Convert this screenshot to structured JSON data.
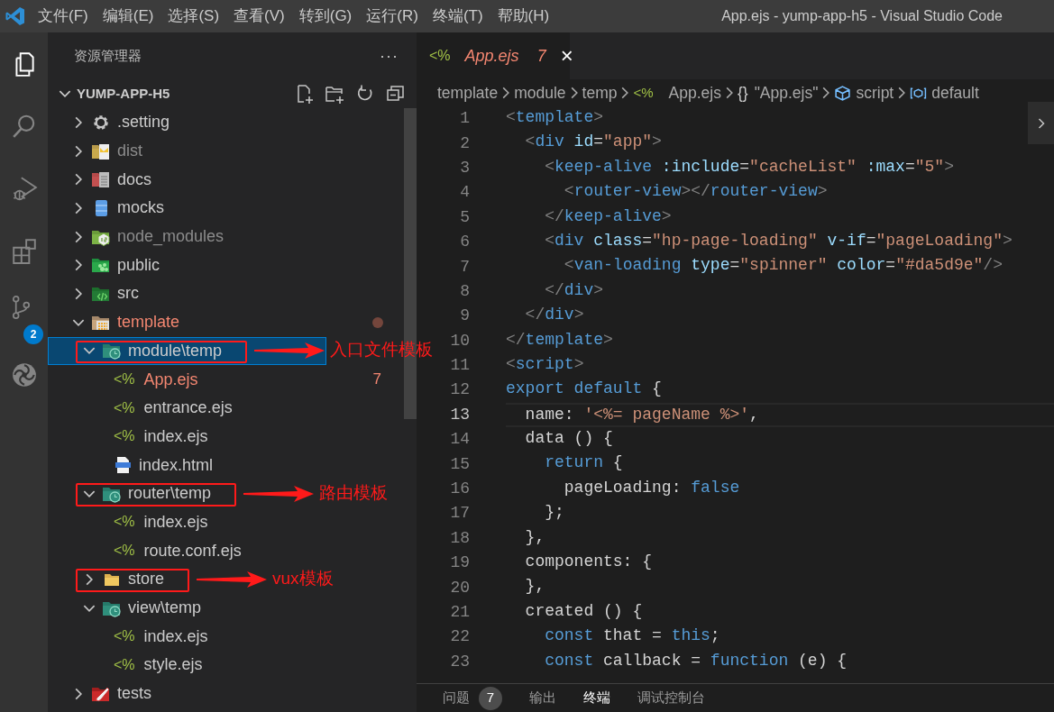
{
  "title_bar": {
    "menus": [
      "文件(F)",
      "编辑(E)",
      "选择(S)",
      "查看(V)",
      "转到(G)",
      "运行(R)",
      "终端(T)",
      "帮助(H)"
    ],
    "title": "App.ejs - yump-app-h5 - Visual Studio Code"
  },
  "activity_bar": [
    {
      "kind": "explorer",
      "selected": true
    },
    {
      "kind": "search",
      "selected": false
    },
    {
      "kind": "run-debug",
      "selected": false
    },
    {
      "kind": "extensions",
      "selected": false
    },
    {
      "kind": "source-control",
      "selected": false,
      "badge": "2"
    },
    {
      "kind": "spiral",
      "selected": false
    }
  ],
  "sidebar": {
    "title": "资源管理器",
    "more": "···",
    "section": {
      "title": "YUMP-APP-H5",
      "expanded": true
    },
    "tree": [
      {
        "name": ".setting",
        "kind": "settings-folder",
        "expanded": false,
        "ignored": false,
        "error": false,
        "selected": false,
        "modified": false
      },
      {
        "name": "dist",
        "kind": "dist-folder",
        "expanded": false,
        "ignored": true,
        "error": false,
        "selected": false,
        "modified": false
      },
      {
        "name": "docs",
        "kind": "docs-folder",
        "expanded": false,
        "ignored": false,
        "error": false,
        "selected": false,
        "modified": false
      },
      {
        "name": "mocks",
        "kind": "mocks-folder",
        "expanded": false,
        "ignored": false,
        "error": false,
        "selected": false,
        "modified": false
      },
      {
        "name": "node_modules",
        "kind": "node-folder",
        "expanded": false,
        "ignored": true,
        "error": false,
        "selected": false,
        "modified": false
      },
      {
        "name": "public",
        "kind": "public-folder",
        "expanded": false,
        "ignored": false,
        "error": false,
        "selected": false,
        "modified": false
      },
      {
        "name": "src",
        "kind": "src-folder",
        "expanded": false,
        "ignored": false,
        "error": false,
        "selected": false,
        "modified": false
      },
      {
        "name": "template",
        "kind": "template-folder",
        "expanded": true,
        "ignored": false,
        "error": true,
        "selected": false,
        "modified": true,
        "children": [
          {
            "name": "module\\temp",
            "kind": "temp-folder",
            "expanded": true,
            "ignored": false,
            "error": false,
            "selected": true,
            "modified": false,
            "annotation": "入口文件模板",
            "children": [
              {
                "name": "App.ejs",
                "kind": "ejs-file",
                "glyph": "<%",
                "ignored": false,
                "error": true,
                "selected": false,
                "modified": false,
                "badge": "7"
              },
              {
                "name": "entrance.ejs",
                "kind": "ejs-file",
                "glyph": "<%",
                "ignored": false,
                "error": false,
                "selected": false,
                "modified": false
              },
              {
                "name": "index.ejs",
                "kind": "ejs-file",
                "glyph": "<%",
                "ignored": false,
                "error": false,
                "selected": false,
                "modified": false
              },
              {
                "name": "index.html",
                "kind": "html-file",
                "ignored": false,
                "error": false,
                "selected": false,
                "modified": false
              }
            ]
          },
          {
            "name": "router\\temp",
            "kind": "temp-folder",
            "expanded": true,
            "ignored": false,
            "error": false,
            "selected": false,
            "modified": false,
            "annotation": "路由模板",
            "children": [
              {
                "name": "index.ejs",
                "kind": "ejs-file",
                "glyph": "<%",
                "ignored": false,
                "error": false,
                "selected": false,
                "modified": false
              },
              {
                "name": "route.conf.ejs",
                "kind": "ejs-file",
                "glyph": "<%",
                "ignored": false,
                "error": false,
                "selected": false,
                "modified": false
              }
            ]
          },
          {
            "name": "store",
            "kind": "folder",
            "expanded": false,
            "ignored": false,
            "error": false,
            "selected": false,
            "modified": false,
            "annotation": "vux模板"
          },
          {
            "name": "view\\temp",
            "kind": "temp-folder",
            "expanded": true,
            "ignored": false,
            "error": false,
            "selected": false,
            "modified": false,
            "children": [
              {
                "name": "index.ejs",
                "kind": "ejs-file",
                "glyph": "<%",
                "ignored": false,
                "error": false,
                "selected": false,
                "modified": false
              },
              {
                "name": "style.ejs",
                "kind": "ejs-file",
                "glyph": "<%",
                "ignored": false,
                "error": false,
                "selected": false,
                "modified": false
              }
            ]
          }
        ]
      },
      {
        "name": "tests",
        "kind": "tests-folder",
        "expanded": false,
        "ignored": false,
        "error": false,
        "selected": false,
        "modified": false
      }
    ]
  },
  "editor": {
    "tabs": [
      {
        "glyph": "<%",
        "title": "App.ejs",
        "badge": "7",
        "error": true,
        "preview": true,
        "selected": true,
        "close": "×"
      }
    ],
    "breadcrumb": [
      {
        "kind": "folder",
        "text": "template"
      },
      {
        "kind": "folder",
        "text": "module"
      },
      {
        "kind": "folder",
        "text": "temp"
      },
      {
        "kind": "file",
        "glyph": "<%",
        "text": "App.ejs"
      },
      {
        "kind": "object",
        "glyph": "{}",
        "text": "\"App.ejs\""
      },
      {
        "kind": "module",
        "text": "script"
      },
      {
        "kind": "variable",
        "text": "default"
      }
    ],
    "lines": [
      {
        "number": "1",
        "current": false,
        "tokens": [
          {
            "kind": "bracket",
            "text": "<"
          },
          {
            "kind": "tag",
            "text": "template"
          },
          {
            "kind": "bracket",
            "text": ">"
          }
        ]
      },
      {
        "number": "2",
        "current": false,
        "tokens": [
          {
            "kind": "bracket",
            "text": "  <"
          },
          {
            "kind": "tag",
            "text": "div"
          },
          {
            "kind": "attr",
            "text": " id"
          },
          {
            "kind": "plain",
            "text": "="
          },
          {
            "kind": "string",
            "text": "\"app\""
          },
          {
            "kind": "bracket",
            "text": ">"
          }
        ]
      },
      {
        "number": "3",
        "current": false,
        "tokens": [
          {
            "kind": "bracket",
            "text": "    <"
          },
          {
            "kind": "tag",
            "text": "keep-alive"
          },
          {
            "kind": "attr",
            "text": " :include"
          },
          {
            "kind": "plain",
            "text": "="
          },
          {
            "kind": "string",
            "text": "\"cacheList\""
          },
          {
            "kind": "attr",
            "text": " :max"
          },
          {
            "kind": "plain",
            "text": "="
          },
          {
            "kind": "string",
            "text": "\"5\""
          },
          {
            "kind": "bracket",
            "text": ">"
          }
        ]
      },
      {
        "number": "4",
        "current": false,
        "tokens": [
          {
            "kind": "bracket",
            "text": "      <"
          },
          {
            "kind": "tag",
            "text": "router-view"
          },
          {
            "kind": "bracket",
            "text": "></"
          },
          {
            "kind": "tag",
            "text": "router-view"
          },
          {
            "kind": "bracket",
            "text": ">"
          }
        ]
      },
      {
        "number": "5",
        "current": false,
        "tokens": [
          {
            "kind": "bracket",
            "text": "    </"
          },
          {
            "kind": "tag",
            "text": "keep-alive"
          },
          {
            "kind": "bracket",
            "text": ">"
          }
        ]
      },
      {
        "number": "6",
        "current": false,
        "tokens": [
          {
            "kind": "bracket",
            "text": "    <"
          },
          {
            "kind": "tag",
            "text": "div"
          },
          {
            "kind": "attr",
            "text": " class"
          },
          {
            "kind": "plain",
            "text": "="
          },
          {
            "kind": "string",
            "text": "\"hp-page-loading\""
          },
          {
            "kind": "attr",
            "text": " v-if"
          },
          {
            "kind": "plain",
            "text": "="
          },
          {
            "kind": "string",
            "text": "\"pageLoading\""
          },
          {
            "kind": "bracket",
            "text": ">"
          }
        ]
      },
      {
        "number": "7",
        "current": false,
        "tokens": [
          {
            "kind": "bracket",
            "text": "      <"
          },
          {
            "kind": "tag",
            "text": "van-loading"
          },
          {
            "kind": "attr",
            "text": " type"
          },
          {
            "kind": "plain",
            "text": "="
          },
          {
            "kind": "string",
            "text": "\"spinner\""
          },
          {
            "kind": "attr",
            "text": " color"
          },
          {
            "kind": "plain",
            "text": "="
          },
          {
            "kind": "string",
            "text": "\"#da5d9e\""
          },
          {
            "kind": "bracket",
            "text": "/>"
          }
        ]
      },
      {
        "number": "8",
        "current": false,
        "tokens": [
          {
            "kind": "bracket",
            "text": "    </"
          },
          {
            "kind": "tag",
            "text": "div"
          },
          {
            "kind": "bracket",
            "text": ">"
          }
        ]
      },
      {
        "number": "9",
        "current": false,
        "tokens": [
          {
            "kind": "bracket",
            "text": "  </"
          },
          {
            "kind": "tag",
            "text": "div"
          },
          {
            "kind": "bracket",
            "text": ">"
          }
        ]
      },
      {
        "number": "10",
        "current": false,
        "tokens": [
          {
            "kind": "bracket",
            "text": "</"
          },
          {
            "kind": "tag",
            "text": "template"
          },
          {
            "kind": "bracket",
            "text": ">"
          }
        ]
      },
      {
        "number": "11",
        "current": false,
        "tokens": [
          {
            "kind": "bracket",
            "text": "<"
          },
          {
            "kind": "tag",
            "text": "script"
          },
          {
            "kind": "bracket",
            "text": ">"
          }
        ]
      },
      {
        "number": "12",
        "current": false,
        "tokens": [
          {
            "kind": "keyword",
            "text": "export"
          },
          {
            "kind": "keyword",
            "text": " default"
          },
          {
            "kind": "plain",
            "text": " {"
          }
        ]
      },
      {
        "number": "13",
        "current": true,
        "tokens": [
          {
            "kind": "plain",
            "text": "  name: "
          },
          {
            "kind": "string",
            "text": "'<%= pageName %>'"
          },
          {
            "kind": "plain",
            "text": ","
          }
        ]
      },
      {
        "number": "14",
        "current": false,
        "tokens": [
          {
            "kind": "plain",
            "text": "  data () {"
          }
        ]
      },
      {
        "number": "15",
        "current": false,
        "tokens": [
          {
            "kind": "keyword",
            "text": "    return"
          },
          {
            "kind": "plain",
            "text": " {"
          }
        ]
      },
      {
        "number": "16",
        "current": false,
        "tokens": [
          {
            "kind": "plain",
            "text": "      pageLoading: "
          },
          {
            "kind": "keyword",
            "text": "false"
          }
        ]
      },
      {
        "number": "17",
        "current": false,
        "tokens": [
          {
            "kind": "plain",
            "text": "    };"
          }
        ]
      },
      {
        "number": "18",
        "current": false,
        "tokens": [
          {
            "kind": "plain",
            "text": "  },"
          }
        ]
      },
      {
        "number": "19",
        "current": false,
        "tokens": [
          {
            "kind": "plain",
            "text": "  components: {"
          }
        ]
      },
      {
        "number": "20",
        "current": false,
        "tokens": [
          {
            "kind": "plain",
            "text": "  },"
          }
        ]
      },
      {
        "number": "21",
        "current": false,
        "tokens": [
          {
            "kind": "plain",
            "text": "  created () {"
          }
        ]
      },
      {
        "number": "22",
        "current": false,
        "tokens": [
          {
            "kind": "keyword",
            "text": "    const"
          },
          {
            "kind": "plain",
            "text": " that = "
          },
          {
            "kind": "keyword",
            "text": "this"
          },
          {
            "kind": "plain",
            "text": ";"
          }
        ]
      },
      {
        "number": "23",
        "current": false,
        "tokens": [
          {
            "kind": "keyword",
            "text": "    const"
          },
          {
            "kind": "plain",
            "text": " callback = "
          },
          {
            "kind": "keyword",
            "text": "function"
          },
          {
            "kind": "plain",
            "text": " (e) {"
          }
        ]
      }
    ]
  },
  "panel": {
    "tabs": [
      {
        "label": "问题",
        "badge": "7",
        "selected": false
      },
      {
        "label": "输出",
        "selected": false
      },
      {
        "label": "终端",
        "selected": true
      },
      {
        "label": "调试控制台",
        "selected": false
      }
    ]
  }
}
